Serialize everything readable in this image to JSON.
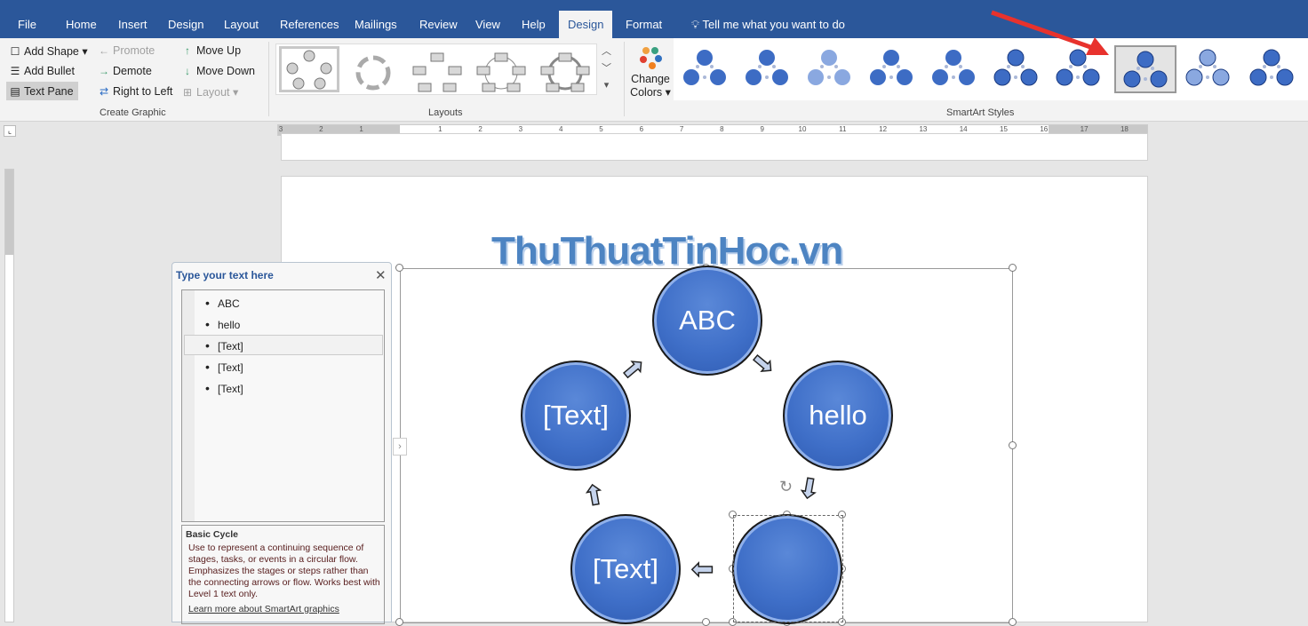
{
  "tabs": [
    {
      "label": "File"
    },
    {
      "label": "Home"
    },
    {
      "label": "Insert"
    },
    {
      "label": "Design"
    },
    {
      "label": "Layout"
    },
    {
      "label": "References"
    },
    {
      "label": "Mailings"
    },
    {
      "label": "Review"
    },
    {
      "label": "View"
    },
    {
      "label": "Help"
    },
    {
      "label": "Design",
      "active": true
    },
    {
      "label": "Format"
    }
  ],
  "tell_me": "Tell me what you want to do",
  "create_graphic": {
    "add_shape": "Add Shape",
    "add_bullet": "Add Bullet",
    "text_pane": "Text Pane",
    "promote": "Promote",
    "demote": "Demote",
    "right_to_left": "Right to Left",
    "move_up": "Move Up",
    "move_down": "Move Down",
    "layout": "Layout",
    "group_label": "Create Graphic"
  },
  "layouts": {
    "group_label": "Layouts"
  },
  "change_colors": {
    "line1": "Change",
    "line2": "Colors"
  },
  "smartart_styles": {
    "group_label": "SmartArt Styles",
    "selected_index": 7,
    "count": 10
  },
  "ruler": {
    "labels": [
      "3",
      "2",
      "1",
      "1",
      "2",
      "3",
      "4",
      "5",
      "6",
      "7",
      "8",
      "9",
      "10",
      "11",
      "12",
      "13",
      "14",
      "15",
      "16",
      "17",
      "18"
    ]
  },
  "watermark": "ThuThuatTinHoc.vn",
  "text_pane": {
    "title": "Type your text here",
    "items": [
      "ABC",
      "hello",
      "[Text]",
      "[Text]",
      "[Text]"
    ],
    "selected_index": 2,
    "desc_title": "Basic Cycle",
    "desc": "Use to represent a continuing sequence of stages, tasks, or events in a circular flow. Emphasizes the stages or steps rather than the connecting arrows or flow. Works best with Level 1 text only.",
    "link": "Learn more about SmartArt graphics"
  },
  "diagram": {
    "shapes": [
      "ABC",
      "hello",
      "",
      "[Text]",
      "[Text]"
    ],
    "fill": "#4472c4"
  },
  "colors": {
    "accent": "#2b579a",
    "annotation_arrow": "#e8322d"
  }
}
